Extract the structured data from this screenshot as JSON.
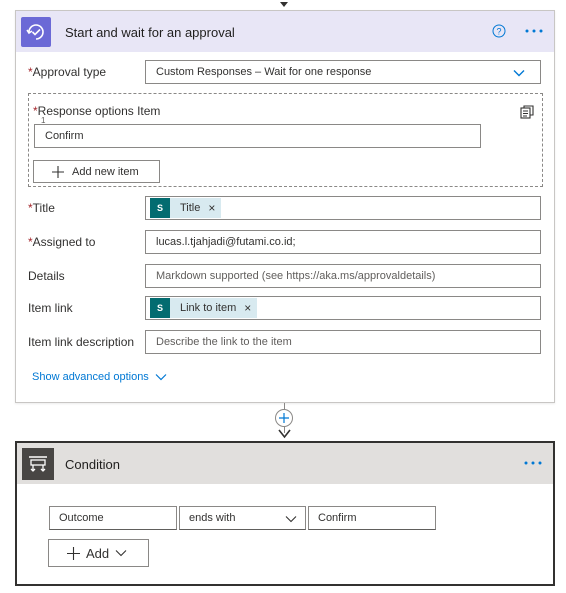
{
  "approval": {
    "title": "Start and wait for an approval",
    "approval_type_label": "Approval type",
    "approval_type_value": "Custom Responses – Wait for one response",
    "response_options_label": "Response options Item",
    "response_item_index": "1",
    "response_item_value": "Confirm",
    "add_new_item_label": "Add new item",
    "title_label": "Title",
    "title_token": "Title",
    "assigned_label": "Assigned to",
    "assigned_value": "lucas.l.tjahjadi@futami.co.id;",
    "details_label": "Details",
    "details_placeholder": "Markdown supported (see https://aka.ms/approvaldetails)",
    "item_link_label": "Item link",
    "item_link_token": "Link to item",
    "item_link_desc_label": "Item link description",
    "item_link_desc_placeholder": "Describe the link to the item",
    "show_advanced": "Show advanced options",
    "required_mark": "*"
  },
  "condition": {
    "title": "Condition",
    "left_operand": "Outcome",
    "operator": "ends with",
    "right_operand": "Confirm",
    "add_label": "Add"
  },
  "icons": {
    "approval": "approval-icon",
    "help": "help-circle-icon",
    "more": "more-dots-icon",
    "chevron": "chevron-down-icon",
    "copy": "copy-icon",
    "plus": "plus-icon",
    "sharepoint": "sharepoint-icon",
    "condition": "condition-icon",
    "close": "close-icon",
    "arrow": "arrow-down-icon"
  },
  "colors": {
    "accent": "#0078d4",
    "approval_header": "#e8e6f6",
    "approval_icon_bg": "#6b69d6",
    "condition_header": "#e1dfdd",
    "condition_icon_bg": "#484644",
    "sharepoint": "#036c70",
    "token_bg": "#d8eaf0",
    "required": "#a4262c"
  }
}
